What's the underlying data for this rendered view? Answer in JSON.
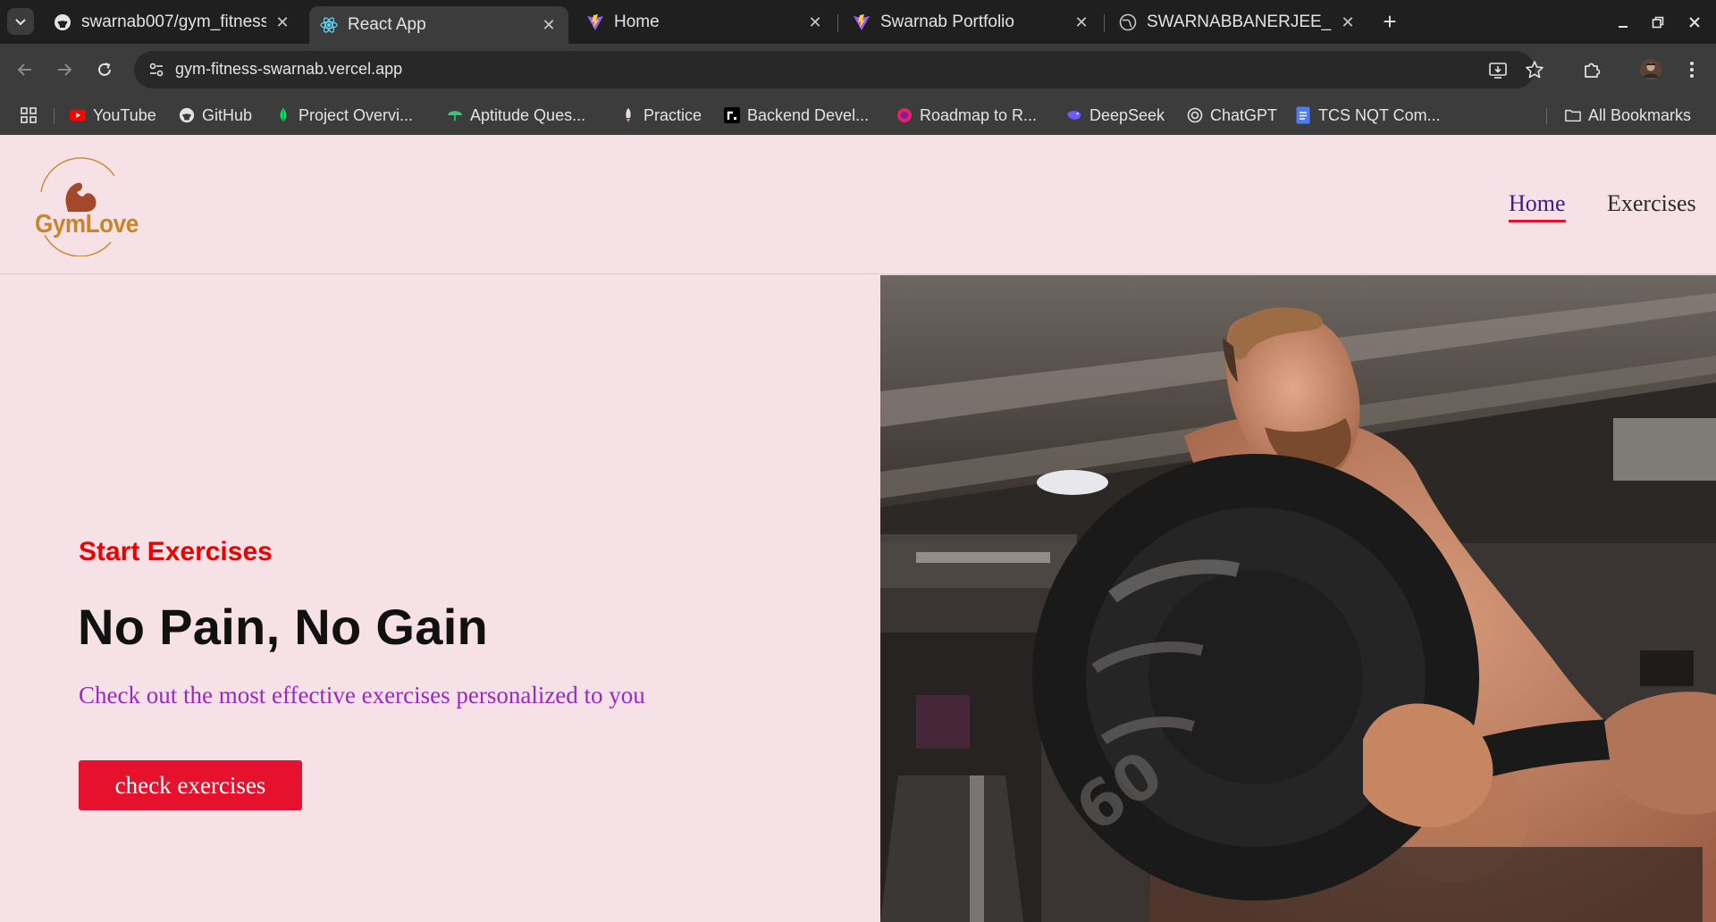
{
  "browser": {
    "tabs": [
      {
        "title": "swarnab007/gym_fitness",
        "icon": "github-icon",
        "active": false
      },
      {
        "title": "React App",
        "icon": "react-icon",
        "active": true
      },
      {
        "title": "Home",
        "icon": "vite-icon",
        "active": false
      },
      {
        "title": "Swarnab Portfolio",
        "icon": "vite-icon",
        "active": false
      },
      {
        "title": "SWARNABBANERJEE_RE",
        "icon": "globe-icon",
        "active": false
      }
    ],
    "url": "gym-fitness-swarnab.vercel.app",
    "bookmarks": [
      {
        "label": "YouTube",
        "icon": "youtube-icon",
        "color": "#ff0000"
      },
      {
        "label": "GitHub",
        "icon": "github-icon",
        "color": "#e3e3e3"
      },
      {
        "label": "Project Overvi...",
        "icon": "mongodb-icon",
        "color": "#00ed64"
      },
      {
        "label": "Aptitude Ques...",
        "icon": "umbrella-icon",
        "color": "#3ec27a"
      },
      {
        "label": "Practice",
        "icon": "rocket-icon",
        "color": "#ff8a65"
      },
      {
        "label": "Backend Devel...",
        "icon": "roadmap-icon",
        "color": "#ffffff"
      },
      {
        "label": "Roadmap to R...",
        "icon": "circle-icon",
        "color": "#e91e63"
      },
      {
        "label": "DeepSeek",
        "icon": "deepseek-icon",
        "color": "#6b5cff"
      },
      {
        "label": "ChatGPT",
        "icon": "chatgpt-icon",
        "color": "#e3e3e3"
      },
      {
        "label": "TCS NQT Com...",
        "icon": "docs-icon",
        "color": "#4e7cf3"
      }
    ],
    "all_bookmarks": "All Bookmarks"
  },
  "site": {
    "logo_text": "GymLove",
    "nav": {
      "home": "Home",
      "exercises": "Exercises"
    },
    "hero": {
      "kicker": "Start Exercises",
      "headline": "No Pain, No Gain",
      "subtitle": "Check out the most effective exercises personalized to you",
      "cta": "check exercises"
    }
  },
  "colors": {
    "page_bg": "#f5e1e6",
    "accent_red": "#e6112c",
    "subtitle_purple": "#9b27c4",
    "logo_gold": "#c8862a"
  }
}
